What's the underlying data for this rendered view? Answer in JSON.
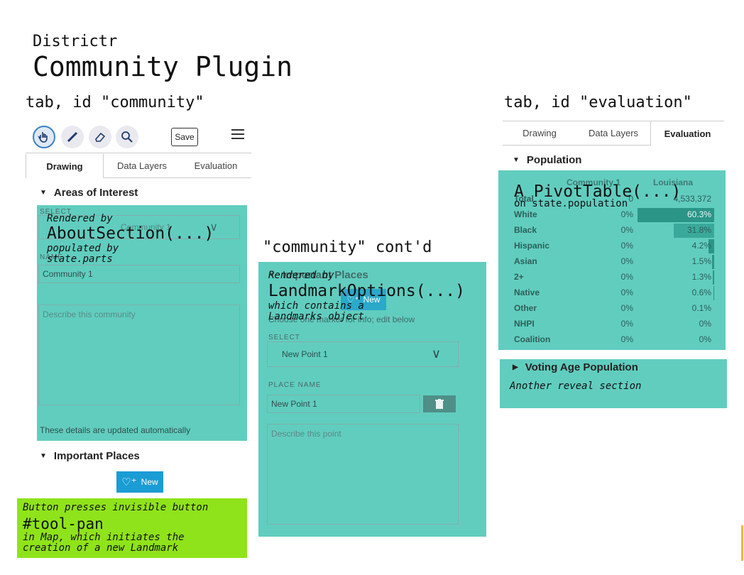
{
  "slide": {
    "subtitle": "Districtr",
    "title": "Community Plugin"
  },
  "captions": {
    "community": "tab, id \"community\"",
    "community_contd": "\"community\" cont'd",
    "evaluation": "tab, id \"evaluation\""
  },
  "left_panel": {
    "tools": [
      "pan-icon",
      "brush-icon",
      "eraser-icon",
      "inspect-icon"
    ],
    "save_label": "Save",
    "tabs": [
      "Drawing",
      "Data Layers",
      "Evaluation"
    ],
    "areas_heading": "Areas of Interest",
    "select_label": "SELECT",
    "select_value": "Community 1",
    "name_label": "NAME",
    "name_value": "Community 1",
    "describe_placeholder": "Describe this community",
    "auto_note": "These details are updated automatically",
    "places_heading": "Important Places",
    "new_label": "New",
    "overlay_about": {
      "line1": "Rendered by",
      "line2": "AboutSection(...)",
      "line3": "populated by",
      "line4": "state.parts"
    },
    "green_note": {
      "line1": "Button presses invisible button",
      "line2": "#tool-pan",
      "line3": "in Map, which initiates the",
      "line4": "creation of a new Landmark"
    }
  },
  "middle_panel": {
    "heading": "Important Places",
    "new_label": "New",
    "hint": "Choose one marker for info; edit below",
    "select_label": "SELECT",
    "select_value": "New Point 1",
    "place_name_label": "PLACE NAME",
    "place_name_value": "New Point 1",
    "describe_placeholder": "Describe this point",
    "overlay": {
      "line1": "Rendered by",
      "line2": "LandmarkOptions(...)",
      "line3": "which contains a",
      "line4": "Landmarks object"
    }
  },
  "right_panel": {
    "tabs": [
      "Drawing",
      "Data Layers",
      "Evaluation"
    ],
    "population_heading": "Population",
    "col1": "Community 1",
    "col2": "Louisiana",
    "rows": [
      {
        "label": "Total",
        "c1": "0",
        "c2": "4,533,372",
        "share": 0
      },
      {
        "label": "White",
        "c1": "0%",
        "c2": "60.3%",
        "share": 0.603
      },
      {
        "label": "Black",
        "c1": "0%",
        "c2": "31.8%",
        "share": 0.318
      },
      {
        "label": "Hispanic",
        "c1": "0%",
        "c2": "4.2%",
        "share": 0.042
      },
      {
        "label": "Asian",
        "c1": "0%",
        "c2": "1.5%",
        "share": 0.015
      },
      {
        "label": "2+",
        "c1": "0%",
        "c2": "1.3%",
        "share": 0.013
      },
      {
        "label": "Native",
        "c1": "0%",
        "c2": "0.6%",
        "share": 0.006
      },
      {
        "label": "Other",
        "c1": "0%",
        "c2": "0.1%",
        "share": 0.001
      },
      {
        "label": "NHPI",
        "c1": "0%",
        "c2": "0%",
        "share": 0
      },
      {
        "label": "Coalition",
        "c1": "0%",
        "c2": "0%",
        "share": 0
      }
    ],
    "overlay": {
      "line1": "A PivotTable(...)",
      "line2": "on state.population"
    },
    "vap_heading": "Voting Age Population",
    "vap_note": "Another reveal section"
  }
}
